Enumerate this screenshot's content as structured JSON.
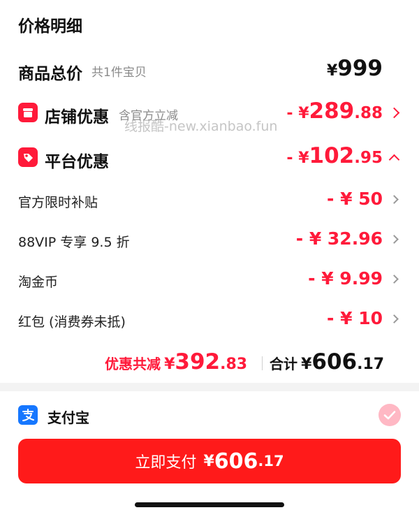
{
  "header": {
    "title": "价格明细"
  },
  "goods_total": {
    "label": "商品总价",
    "sub": "共1件宝贝",
    "currency": "¥",
    "amount": "999"
  },
  "store_discount": {
    "label": "店铺优惠",
    "sub": "含官方立减",
    "prefix": "- ¥",
    "int": "289",
    "dec": ".88",
    "icon": "store-icon"
  },
  "watermark": "线报酷-new.xianbao.fun",
  "platform_discount": {
    "label": "平台优惠",
    "prefix": "- ¥",
    "int": "102",
    "dec": ".95",
    "icon": "tag-icon"
  },
  "details": [
    {
      "label": "官方限时补贴",
      "amount": "- ¥ 50"
    },
    {
      "label": "88VIP 专享 9.5 折",
      "amount": "- ¥ 32.96"
    },
    {
      "label": "淘金币",
      "amount": "- ¥ 9.99"
    },
    {
      "label": "红包 (消费券未抵)",
      "amount": "- ¥ 10"
    }
  ],
  "summary": {
    "discount_label": "优惠共减",
    "discount_currency": "¥",
    "discount_int": "392",
    "discount_dec": ".83",
    "total_label": "合计",
    "total_currency": "¥",
    "total_int": "606",
    "total_dec": ".17"
  },
  "payment": {
    "method": "支付宝",
    "icon": "alipay-icon",
    "selected": true
  },
  "pay_button": {
    "label": "立即支付",
    "currency": "¥",
    "int": "606",
    "dec": ".17"
  },
  "colors": {
    "accent": "#ff1a3a",
    "button": "#ff1a1a",
    "alipay": "#1677ff"
  }
}
